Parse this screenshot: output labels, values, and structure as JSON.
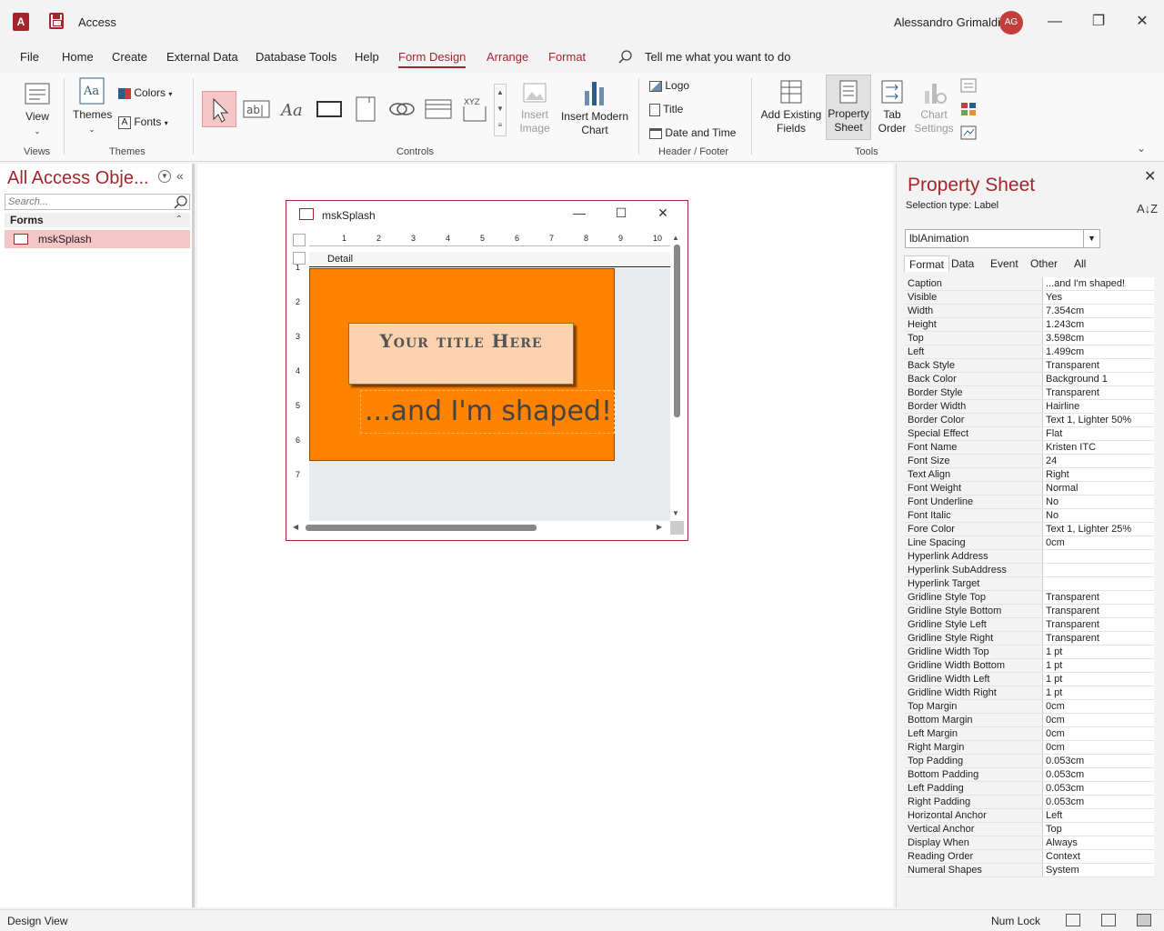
{
  "app": {
    "logo_letter": "A",
    "title": "Access",
    "user_name": "Alessandro Grimaldi",
    "user_initials": "AG"
  },
  "menu": {
    "tabs": [
      "File",
      "Home",
      "Create",
      "External Data",
      "Database Tools",
      "Help",
      "Form Design",
      "Arrange",
      "Format"
    ],
    "active": "Form Design",
    "tell_me": "Tell me what you want to do"
  },
  "ribbon": {
    "views": {
      "view_label": "View",
      "group": "Views"
    },
    "themes": {
      "themes_label": "Themes",
      "colors_label": "Colors",
      "fonts_label": "Fonts",
      "group": "Themes"
    },
    "controls": {
      "group": "Controls",
      "insert_image": "Insert Image",
      "insert_chart": "Insert Modern Chart"
    },
    "header_footer": {
      "logo": "Logo",
      "title": "Title",
      "date_time": "Date and Time",
      "group": "Header / Footer"
    },
    "tools": {
      "add_fields": "Add Existing Fields",
      "property_sheet": "Property Sheet",
      "tab_order": "Tab Order",
      "chart_settings": "Chart Settings",
      "group": "Tools"
    }
  },
  "nav": {
    "title": "All Access Obje...",
    "search_placeholder": "Search...",
    "group": "Forms",
    "items": [
      "mskSplash"
    ]
  },
  "form": {
    "title": "mskSplash",
    "ruler_numbers": [
      "1",
      "2",
      "3",
      "4",
      "5",
      "6",
      "7",
      "8",
      "9",
      "10"
    ],
    "vruler_numbers": [
      "1",
      "2",
      "3",
      "4",
      "5",
      "6",
      "7"
    ],
    "section": "Detail",
    "title_text": "Your title Here",
    "shaped_text": "...and I'm shaped!",
    "background_color": "#ff8300"
  },
  "property_sheet": {
    "title": "Property Sheet",
    "selection_type": "Selection type:  Label",
    "control": "lblAnimation",
    "tabs": [
      "Format",
      "Data",
      "Event",
      "Other",
      "All"
    ],
    "active_tab": "Format",
    "rows": [
      [
        "Caption",
        "...and I'm shaped!"
      ],
      [
        "Visible",
        "Yes"
      ],
      [
        "Width",
        "7.354cm"
      ],
      [
        "Height",
        "1.243cm"
      ],
      [
        "Top",
        "3.598cm"
      ],
      [
        "Left",
        "1.499cm"
      ],
      [
        "Back Style",
        "Transparent"
      ],
      [
        "Back Color",
        "Background 1"
      ],
      [
        "Border Style",
        "Transparent"
      ],
      [
        "Border Width",
        "Hairline"
      ],
      [
        "Border Color",
        "Text 1, Lighter 50%"
      ],
      [
        "Special Effect",
        "Flat"
      ],
      [
        "Font Name",
        "Kristen ITC"
      ],
      [
        "Font Size",
        "24"
      ],
      [
        "Text Align",
        "Right"
      ],
      [
        "Font Weight",
        "Normal"
      ],
      [
        "Font Underline",
        "No"
      ],
      [
        "Font Italic",
        "No"
      ],
      [
        "Fore Color",
        "Text 1, Lighter 25%"
      ],
      [
        "Line Spacing",
        "0cm"
      ],
      [
        "Hyperlink Address",
        ""
      ],
      [
        "Hyperlink SubAddress",
        ""
      ],
      [
        "Hyperlink Target",
        ""
      ],
      [
        "Gridline Style Top",
        "Transparent"
      ],
      [
        "Gridline Style Bottom",
        "Transparent"
      ],
      [
        "Gridline Style Left",
        "Transparent"
      ],
      [
        "Gridline Style Right",
        "Transparent"
      ],
      [
        "Gridline Width Top",
        "1 pt"
      ],
      [
        "Gridline Width Bottom",
        "1 pt"
      ],
      [
        "Gridline Width Left",
        "1 pt"
      ],
      [
        "Gridline Width Right",
        "1 pt"
      ],
      [
        "Top Margin",
        "0cm"
      ],
      [
        "Bottom Margin",
        "0cm"
      ],
      [
        "Left Margin",
        "0cm"
      ],
      [
        "Right Margin",
        "0cm"
      ],
      [
        "Top Padding",
        "0.053cm"
      ],
      [
        "Bottom Padding",
        "0.053cm"
      ],
      [
        "Left Padding",
        "0.053cm"
      ],
      [
        "Right Padding",
        "0.053cm"
      ],
      [
        "Horizontal Anchor",
        "Left"
      ],
      [
        "Vertical Anchor",
        "Top"
      ],
      [
        "Display When",
        "Always"
      ],
      [
        "Reading Order",
        "Context"
      ],
      [
        "Numeral Shapes",
        "System"
      ]
    ]
  },
  "status": {
    "left": "Design View",
    "num_lock": "Num Lock"
  },
  "colors": {
    "accent": "#a4262c",
    "selected_bg": "#f4c6c6"
  }
}
